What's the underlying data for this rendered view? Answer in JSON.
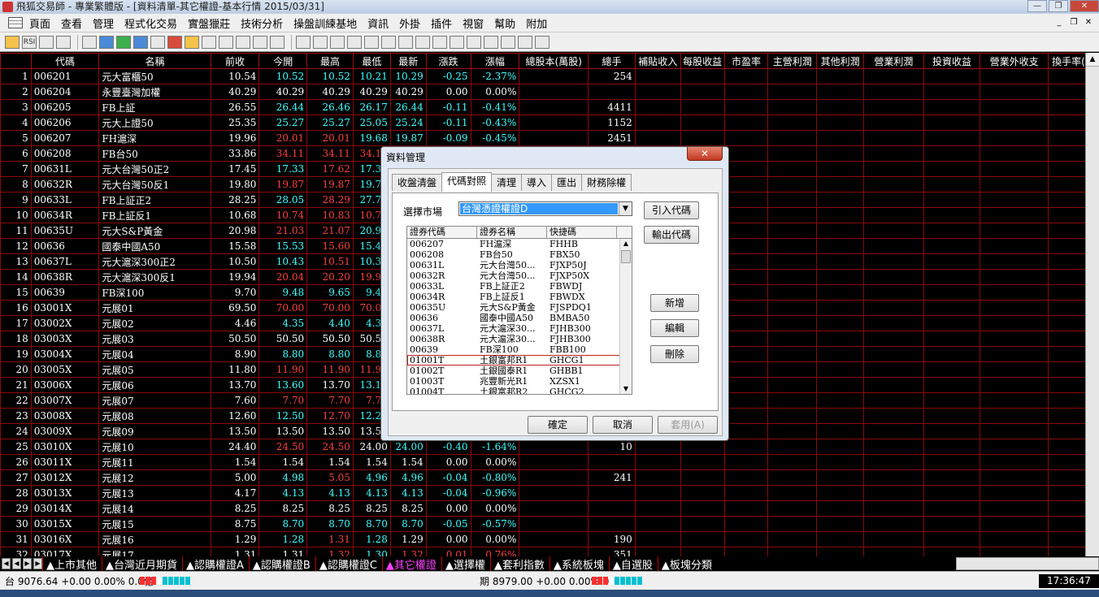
{
  "window": {
    "title": "飛狐交易師 - 專業繁體版 - [資料清單-其它權證-基本行情 2015/03/31]",
    "controls": [
      "minimize-icon",
      "restore-icon",
      "close-icon"
    ],
    "control_glyphs": [
      "—",
      "❐",
      "✕"
    ],
    "mdi_glyphs": [
      "_",
      "❐",
      "✕"
    ]
  },
  "menu": [
    "頁面",
    "查看",
    "管理",
    "程式化交易",
    "實盤獵莊",
    "技術分析",
    "操盤訓練基地",
    "資訊",
    "外掛",
    "插件",
    "視窗",
    "幫助",
    "附加"
  ],
  "toolbar": {
    "rsi_label": "RSI"
  },
  "grid": {
    "columns": [
      "",
      "代碼",
      "名稱",
      "前收",
      "今開",
      "最高",
      "最低",
      "最新",
      "漲跌",
      "漲幅",
      "總股本(萬股)",
      "總手",
      "補貼收入",
      "每股收益",
      "市盈率",
      "主營利潤",
      "其他利潤",
      "營業利潤",
      "投資收益",
      "營業外收支",
      "換手率(首"
    ],
    "rows": [
      {
        "n": "1",
        "code": "006201",
        "name": "元大富櫃50",
        "prev": "10.54",
        "open": "10.52",
        "high": "10.52",
        "low": "10.21",
        "last": "10.29",
        "chg": "-0.25",
        "pct": "-2.37%",
        "vol": "254",
        "d": [
          "down",
          "down",
          "down",
          "down",
          "down",
          "down"
        ]
      },
      {
        "n": "2",
        "code": "006204",
        "name": "永豐臺灣加權",
        "prev": "40.29",
        "open": "40.29",
        "high": "40.29",
        "low": "40.29",
        "last": "40.29",
        "chg": "0.00",
        "pct": "0.00%",
        "vol": "",
        "d": [
          "flat",
          "flat",
          "flat",
          "flat",
          "flat",
          "flat"
        ]
      },
      {
        "n": "3",
        "code": "006205",
        "name": "FB上証",
        "prev": "26.55",
        "open": "26.44",
        "high": "26.46",
        "low": "26.17",
        "last": "26.44",
        "chg": "-0.11",
        "pct": "-0.41%",
        "vol": "4411",
        "d": [
          "down",
          "down",
          "down",
          "down",
          "down",
          "down"
        ]
      },
      {
        "n": "4",
        "code": "006206",
        "name": "元大上證50",
        "prev": "25.35",
        "open": "25.27",
        "high": "25.27",
        "low": "25.05",
        "last": "25.24",
        "chg": "-0.11",
        "pct": "-0.43%",
        "vol": "1152",
        "d": [
          "down",
          "down",
          "down",
          "down",
          "down",
          "down"
        ]
      },
      {
        "n": "5",
        "code": "006207",
        "name": "FH滬深",
        "prev": "19.96",
        "open": "20.01",
        "high": "20.01",
        "low": "19.68",
        "last": "19.87",
        "chg": "-0.09",
        "pct": "-0.45%",
        "vol": "2451",
        "d": [
          "up",
          "up",
          "down",
          "down",
          "down",
          "down"
        ]
      },
      {
        "n": "6",
        "code": "006208",
        "name": "FB台50",
        "prev": "33.86",
        "open": "34.11",
        "high": "34.11",
        "low": "34.11",
        "last": "",
        "chg": "",
        "pct": "",
        "vol": "",
        "d": [
          "up",
          "up",
          "up",
          "up",
          "up",
          "up"
        ]
      },
      {
        "n": "7",
        "code": "00631L",
        "name": "元大台灣50正2",
        "prev": "17.45",
        "open": "17.33",
        "high": "17.62",
        "low": "17.33",
        "last": "",
        "chg": "",
        "pct": "",
        "vol": "",
        "d": [
          "down",
          "up",
          "down",
          "down",
          "down",
          "down"
        ]
      },
      {
        "n": "8",
        "code": "00632R",
        "name": "元大台灣50反1",
        "prev": "19.80",
        "open": "19.87",
        "high": "19.87",
        "low": "19.71",
        "last": "",
        "chg": "",
        "pct": "",
        "vol": "",
        "d": [
          "up",
          "up",
          "down",
          "down",
          "down",
          "down"
        ]
      },
      {
        "n": "9",
        "code": "00633L",
        "name": "FB上証正2",
        "prev": "28.25",
        "open": "28.05",
        "high": "28.29",
        "low": "27.71",
        "last": "",
        "chg": "",
        "pct": "",
        "vol": "",
        "d": [
          "down",
          "up",
          "down",
          "down",
          "down",
          "down"
        ]
      },
      {
        "n": "10",
        "code": "00634R",
        "name": "FB上証反1",
        "prev": "10.68",
        "open": "10.74",
        "high": "10.83",
        "low": "10.70",
        "last": "",
        "chg": "",
        "pct": "",
        "vol": "",
        "d": [
          "up",
          "up",
          "up",
          "up",
          "up",
          "up"
        ]
      },
      {
        "n": "11",
        "code": "00635U",
        "name": "元大S&P黃金",
        "prev": "20.98",
        "open": "21.03",
        "high": "21.07",
        "low": "20.97",
        "last": "",
        "chg": "",
        "pct": "",
        "vol": "",
        "d": [
          "up",
          "up",
          "down",
          "down",
          "down",
          "down"
        ]
      },
      {
        "n": "12",
        "code": "00636",
        "name": "國泰中國A50",
        "prev": "15.58",
        "open": "15.53",
        "high": "15.60",
        "low": "15.44",
        "last": "",
        "chg": "",
        "pct": "",
        "vol": "",
        "d": [
          "down",
          "up",
          "down",
          "down",
          "down",
          "down"
        ]
      },
      {
        "n": "13",
        "code": "00637L",
        "name": "元大滬深300正2",
        "prev": "10.50",
        "open": "10.43",
        "high": "10.51",
        "low": "10.31",
        "last": "",
        "chg": "",
        "pct": "",
        "vol": "",
        "d": [
          "down",
          "up",
          "down",
          "down",
          "down",
          "down"
        ]
      },
      {
        "n": "14",
        "code": "00638R",
        "name": "元大滬深300反1",
        "prev": "19.94",
        "open": "20.04",
        "high": "20.20",
        "low": "19.97",
        "last": "",
        "chg": "",
        "pct": "",
        "vol": "",
        "d": [
          "up",
          "up",
          "up",
          "up",
          "up",
          "up"
        ]
      },
      {
        "n": "15",
        "code": "00639",
        "name": "FB深100",
        "prev": "9.70",
        "open": "9.48",
        "high": "9.65",
        "low": "9.48",
        "last": "",
        "chg": "",
        "pct": "",
        "vol": "",
        "d": [
          "down",
          "down",
          "down",
          "down",
          "down",
          "down"
        ]
      },
      {
        "n": "16",
        "code": "03001X",
        "name": "元展01",
        "prev": "69.50",
        "open": "70.00",
        "high": "70.00",
        "low": "70.00",
        "last": "",
        "chg": "",
        "pct": "",
        "vol": "",
        "d": [
          "up",
          "up",
          "up",
          "up",
          "up",
          "up"
        ]
      },
      {
        "n": "17",
        "code": "03002X",
        "name": "元展02",
        "prev": "4.46",
        "open": "4.35",
        "high": "4.40",
        "low": "4.35",
        "last": "",
        "chg": "",
        "pct": "",
        "vol": "",
        "d": [
          "down",
          "down",
          "down",
          "down",
          "down",
          "down"
        ]
      },
      {
        "n": "18",
        "code": "03003X",
        "name": "元展03",
        "prev": "50.50",
        "open": "50.50",
        "high": "50.50",
        "low": "50.50",
        "last": "",
        "chg": "",
        "pct": "",
        "vol": "",
        "d": [
          "flat",
          "flat",
          "flat",
          "flat",
          "flat",
          "flat"
        ]
      },
      {
        "n": "19",
        "code": "03004X",
        "name": "元展04",
        "prev": "8.90",
        "open": "8.80",
        "high": "8.80",
        "low": "8.80",
        "last": "",
        "chg": "",
        "pct": "",
        "vol": "",
        "d": [
          "down",
          "down",
          "down",
          "down",
          "down",
          "down"
        ]
      },
      {
        "n": "20",
        "code": "03005X",
        "name": "元展05",
        "prev": "11.80",
        "open": "11.90",
        "high": "11.90",
        "low": "11.90",
        "last": "",
        "chg": "",
        "pct": "",
        "vol": "",
        "d": [
          "up",
          "up",
          "up",
          "up",
          "up",
          "up"
        ]
      },
      {
        "n": "21",
        "code": "03006X",
        "name": "元展06",
        "prev": "13.70",
        "open": "13.60",
        "high": "13.70",
        "low": "13.10",
        "last": "",
        "chg": "",
        "pct": "",
        "vol": "",
        "d": [
          "down",
          "flat",
          "down",
          "down",
          "down",
          "down"
        ]
      },
      {
        "n": "22",
        "code": "03007X",
        "name": "元展07",
        "prev": "7.60",
        "open": "7.70",
        "high": "7.70",
        "low": "7.70",
        "last": "",
        "chg": "",
        "pct": "",
        "vol": "",
        "d": [
          "up",
          "up",
          "up",
          "up",
          "up",
          "up"
        ]
      },
      {
        "n": "23",
        "code": "03008X",
        "name": "元展08",
        "prev": "12.60",
        "open": "12.50",
        "high": "12.70",
        "low": "12.20",
        "last": "",
        "chg": "",
        "pct": "",
        "vol": "",
        "d": [
          "down",
          "up",
          "down",
          "down",
          "down",
          "down"
        ]
      },
      {
        "n": "24",
        "code": "03009X",
        "name": "元展09",
        "prev": "13.50",
        "open": "13.50",
        "high": "13.50",
        "low": "13.50",
        "last": "",
        "chg": "",
        "pct": "",
        "vol": "",
        "d": [
          "flat",
          "flat",
          "flat",
          "flat",
          "flat",
          "flat"
        ]
      },
      {
        "n": "25",
        "code": "03010X",
        "name": "元展10",
        "prev": "24.40",
        "open": "24.50",
        "high": "24.50",
        "low": "24.00",
        "last": "24.00",
        "chg": "-0.40",
        "pct": "-1.64%",
        "vol": "10",
        "d": [
          "up",
          "up",
          "flat",
          "down",
          "down",
          "down"
        ]
      },
      {
        "n": "26",
        "code": "03011X",
        "name": "元展11",
        "prev": "1.54",
        "open": "1.54",
        "high": "1.54",
        "low": "1.54",
        "last": "1.54",
        "chg": "0.00",
        "pct": "0.00%",
        "vol": "",
        "d": [
          "flat",
          "flat",
          "flat",
          "flat",
          "flat",
          "flat"
        ]
      },
      {
        "n": "27",
        "code": "03012X",
        "name": "元展12",
        "prev": "5.00",
        "open": "4.98",
        "high": "5.05",
        "low": "4.96",
        "last": "4.96",
        "chg": "-0.04",
        "pct": "-0.80%",
        "vol": "241",
        "d": [
          "down",
          "up",
          "down",
          "down",
          "down",
          "down"
        ]
      },
      {
        "n": "28",
        "code": "03013X",
        "name": "元展13",
        "prev": "4.17",
        "open": "4.13",
        "high": "4.13",
        "low": "4.13",
        "last": "4.13",
        "chg": "-0.04",
        "pct": "-0.96%",
        "vol": "",
        "d": [
          "down",
          "down",
          "down",
          "down",
          "down",
          "down"
        ]
      },
      {
        "n": "29",
        "code": "03014X",
        "name": "元展14",
        "prev": "8.25",
        "open": "8.25",
        "high": "8.25",
        "low": "8.25",
        "last": "8.25",
        "chg": "0.00",
        "pct": "0.00%",
        "vol": "",
        "d": [
          "flat",
          "flat",
          "flat",
          "flat",
          "flat",
          "flat"
        ]
      },
      {
        "n": "30",
        "code": "03015X",
        "name": "元展15",
        "prev": "8.75",
        "open": "8.70",
        "high": "8.70",
        "low": "8.70",
        "last": "8.70",
        "chg": "-0.05",
        "pct": "-0.57%",
        "vol": "",
        "d": [
          "down",
          "down",
          "down",
          "down",
          "down",
          "down"
        ]
      },
      {
        "n": "31",
        "code": "03016X",
        "name": "元展16",
        "prev": "1.29",
        "open": "1.28",
        "high": "1.31",
        "low": "1.28",
        "last": "1.29",
        "chg": "0.00",
        "pct": "0.00%",
        "vol": "190",
        "d": [
          "down",
          "up",
          "down",
          "flat",
          "flat",
          "flat"
        ]
      },
      {
        "n": "32",
        "code": "03017X",
        "name": "元展17",
        "prev": "1.31",
        "open": "1.31",
        "high": "1.32",
        "low": "1.30",
        "last": "1.32",
        "chg": "0.01",
        "pct": "0.76%",
        "vol": "351",
        "d": [
          "flat",
          "up",
          "down",
          "up",
          "up",
          "up"
        ]
      }
    ]
  },
  "sheet_tabs": [
    {
      "label": "▲上市其他",
      "active": false
    },
    {
      "label": "▲台灣近月期貨",
      "active": false
    },
    {
      "label": "▲認購權證A",
      "active": false
    },
    {
      "label": "▲認購權證B",
      "active": false
    },
    {
      "label": "▲認購權證C",
      "active": false
    },
    {
      "label": "▲其它權證",
      "active": true
    },
    {
      "label": "▲選擇權",
      "active": false
    },
    {
      "label": "▲套利指數",
      "active": false
    },
    {
      "label": "▲系統板塊",
      "active": false
    },
    {
      "label": "▲自選股",
      "active": false
    },
    {
      "label": "▲板塊分類",
      "active": false
    }
  ],
  "status": {
    "tw_index": "台 9076.64 +0.00 0.00% 0.0億",
    "futures": "期 8979.00 +0.00  0.00% 0",
    "clock": "17:36:47",
    "bar_colors": [
      "#ff3030",
      "#ff3030",
      "#ff3030",
      "#ffffff",
      "#00c0d0",
      "#00c0d0",
      "#00c0d0",
      "#00c0d0",
      "#00c0d0"
    ]
  },
  "dialog": {
    "title": "資料管理",
    "close": "✕",
    "tabs": [
      {
        "label": "收盤清盤",
        "active": false
      },
      {
        "label": "代碼對照",
        "active": true
      },
      {
        "label": "清理",
        "active": false
      },
      {
        "label": "導入",
        "active": false
      },
      {
        "label": "匯出",
        "active": false
      },
      {
        "label": "財務除權",
        "active": false
      }
    ],
    "market_label": "選擇市場",
    "market_value": "台灣憑證權證D",
    "list_headers": [
      "證券代碼",
      "證券名稱",
      "快捷碼"
    ],
    "list_rows": [
      [
        "006207",
        "FH滬深",
        "FHHB"
      ],
      [
        "006208",
        "FB台50",
        "FBX50"
      ],
      [
        "00631L",
        "元大台灣50...",
        "FJXP50J"
      ],
      [
        "00632R",
        "元大台灣50...",
        "FJXP50X"
      ],
      [
        "00633L",
        "FB上証正2",
        "FBWDJ"
      ],
      [
        "00634R",
        "FB上証反1",
        "FBWDX"
      ],
      [
        "00635U",
        "元大S&P黃金",
        "FJSPDQ1"
      ],
      [
        "00636",
        "國泰中國A50",
        "BMBA50"
      ],
      [
        "00637L",
        "元大滬深30...",
        "FJHB300"
      ],
      [
        "00638R",
        "元大滬深30...",
        "FJHB300"
      ],
      [
        "00639",
        "FB深100",
        "FBB100"
      ],
      [
        "01001T",
        "土銀富邦R1",
        "GHCG1"
      ],
      [
        "01002T",
        "土銀國泰R1",
        "GHBB1"
      ],
      [
        "01003T",
        "兆豐新光R1",
        "XZSX1"
      ],
      [
        "01004T",
        "土銀富邦R2",
        "GHCG2"
      ]
    ],
    "buttons": {
      "import_code": "引入代碼",
      "export_code": "輸出代碼",
      "add": "新增",
      "edit": "編輯",
      "delete": "刪除",
      "ok": "確定",
      "cancel": "取消",
      "apply": "套用(A)"
    }
  }
}
